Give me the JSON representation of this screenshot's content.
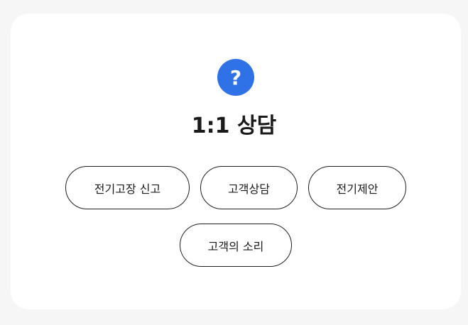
{
  "header": {
    "icon": "question-mark-icon",
    "icon_glyph": "?",
    "icon_color": "#2f71e6",
    "title": "1:1 상담"
  },
  "buttons": [
    {
      "label": "전기고장 신고"
    },
    {
      "label": "고객상담"
    },
    {
      "label": "전기제안"
    },
    {
      "label": "고객의 소리"
    }
  ]
}
